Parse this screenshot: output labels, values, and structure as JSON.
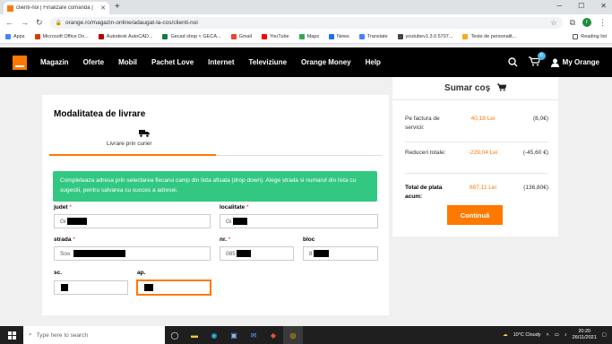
{
  "browser": {
    "tab_title": "clienti-noi | Finalizare comanda |",
    "url": "orange.ro/magazin-online/adaugat-la-cos/clienti-noi",
    "avatar_letter": "r",
    "bookmarks": [
      {
        "label": "Apps",
        "color": "#4285f4"
      },
      {
        "label": "Microsoft Office Do...",
        "color": "#d83b01"
      },
      {
        "label": "Autodesk AutoCAD...",
        "color": "#b40000"
      },
      {
        "label": "Gecad shop < GECA...",
        "color": "#0f7d3c"
      },
      {
        "label": "Gmail",
        "color": "#ea4335"
      },
      {
        "label": "YouTube",
        "color": "#ff0000"
      },
      {
        "label": "Maps",
        "color": "#34a853"
      },
      {
        "label": "News",
        "color": "#1a73e8"
      },
      {
        "label": "Translate",
        "color": "#4285f4"
      },
      {
        "label": "youtubev1.3.0.5707...",
        "color": "#444444"
      },
      {
        "label": "Teste de personalit...",
        "color": "#f9a825"
      }
    ],
    "reading_list": "Reading list"
  },
  "site": {
    "nav": [
      "Magazin",
      "Oferte",
      "Mobil",
      "Pachet Love",
      "Internet",
      "Televiziune",
      "Orange Money",
      "Help"
    ],
    "cart_count": "0",
    "account_label": "My Orange",
    "accent": "#ff7900"
  },
  "delivery": {
    "title": "Modalitatea de livrare",
    "tab_label": "Livrare prin curier",
    "info": "Completeaza adresa prin selectarea fiecarui camp din lista afisata (drop down). Alege strada si numarul din lista cu sugestii, pentru salvarea cu succes a adresei.",
    "fields": {
      "judet": {
        "label": "judet",
        "value": "Gi"
      },
      "localitate": {
        "label": "localitate",
        "value": "Gi"
      },
      "strada": {
        "label": "strada",
        "value": "Sos"
      },
      "nr": {
        "label": "nr.",
        "value": "085"
      },
      "bloc": {
        "label": "bloc",
        "value": "8"
      },
      "sc": {
        "label": "sc.",
        "value": ""
      },
      "ap": {
        "label": "ap.",
        "value": ""
      }
    },
    "required_mark": "*"
  },
  "summary": {
    "title": "Sumar coș",
    "rows": [
      {
        "key": "Pe factura de servicii:",
        "value": "40,18 Lei",
        "euro": "(8,0€)"
      },
      {
        "key": "Reduceri totale:",
        "value": "-229,04 Lei",
        "euro": "(-45,60 €)"
      },
      {
        "key": "Total de plata acum:",
        "value": "687,11 Lei",
        "euro": "(136,80€)"
      }
    ],
    "continue_label": "Continuă"
  },
  "taskbar": {
    "search_placeholder": "Type here to search",
    "weather": "10°C  Cloudy",
    "time": "20:20",
    "date": "26/11/2021"
  }
}
